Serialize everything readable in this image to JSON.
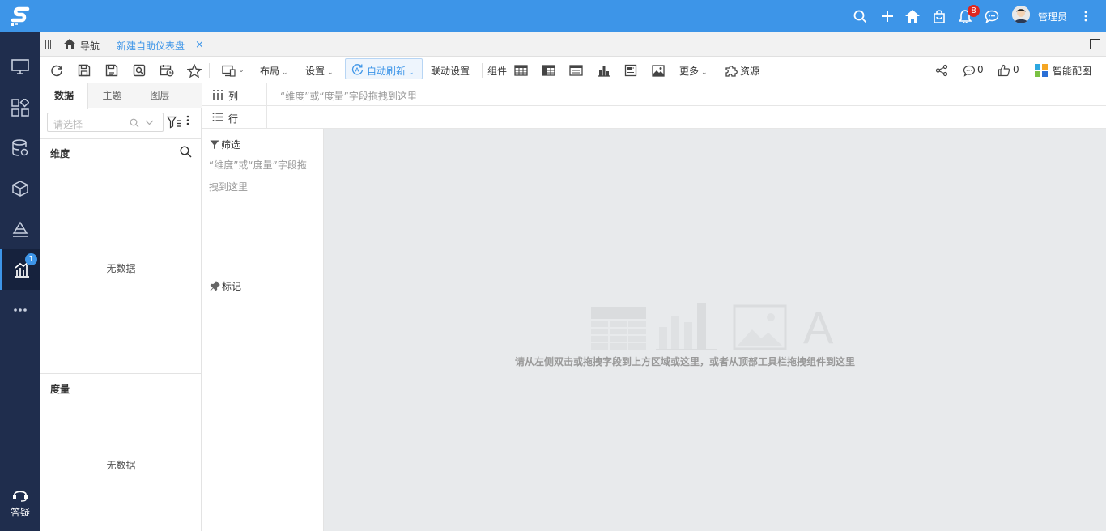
{
  "header": {
    "user_name": "管理员",
    "notification_count": "8"
  },
  "rail": {
    "active_badge": "1",
    "help_label": "答疑"
  },
  "tabstrip": {
    "nav_label": "导航",
    "active_tab": "新建自助仪表盘",
    "close_glyph": "×"
  },
  "toolbar": {
    "layout_label": "布局",
    "settings_label": "设置",
    "auto_refresh_label": "自动刷新",
    "linkage_label": "联动设置",
    "component_label": "组件",
    "more_label": "更多",
    "resource_label": "资源",
    "comment_count": "0",
    "like_count": "0",
    "smart_color_label": "智能配图"
  },
  "data_panel": {
    "tabs": [
      {
        "label": "数据"
      },
      {
        "label": "主题"
      },
      {
        "label": "图层"
      }
    ],
    "select_placeholder": "请选择",
    "dimension_title": "维度",
    "dimension_empty": "无数据",
    "measure_title": "度量",
    "measure_empty": "无数据"
  },
  "shelves": {
    "column_label": "列",
    "row_label": "行",
    "drop_hint": "“维度”或“度量”字段拖拽到这里"
  },
  "filter_panel": {
    "filter_label": "筛选",
    "filter_hint": "“维度”或“度量”字段拖拽到这里",
    "mark_label": "标记"
  },
  "canvas": {
    "empty_hint": "请从左侧双击或拖拽字段到上方区域或这里，或者从顶部工具栏拖拽组件到这里"
  },
  "colors": {
    "brand_blue": "#3d95e8",
    "rail_navy": "#1f2d4d",
    "badge_red": "#e0261f",
    "canvas_gray": "#e8eaec"
  }
}
